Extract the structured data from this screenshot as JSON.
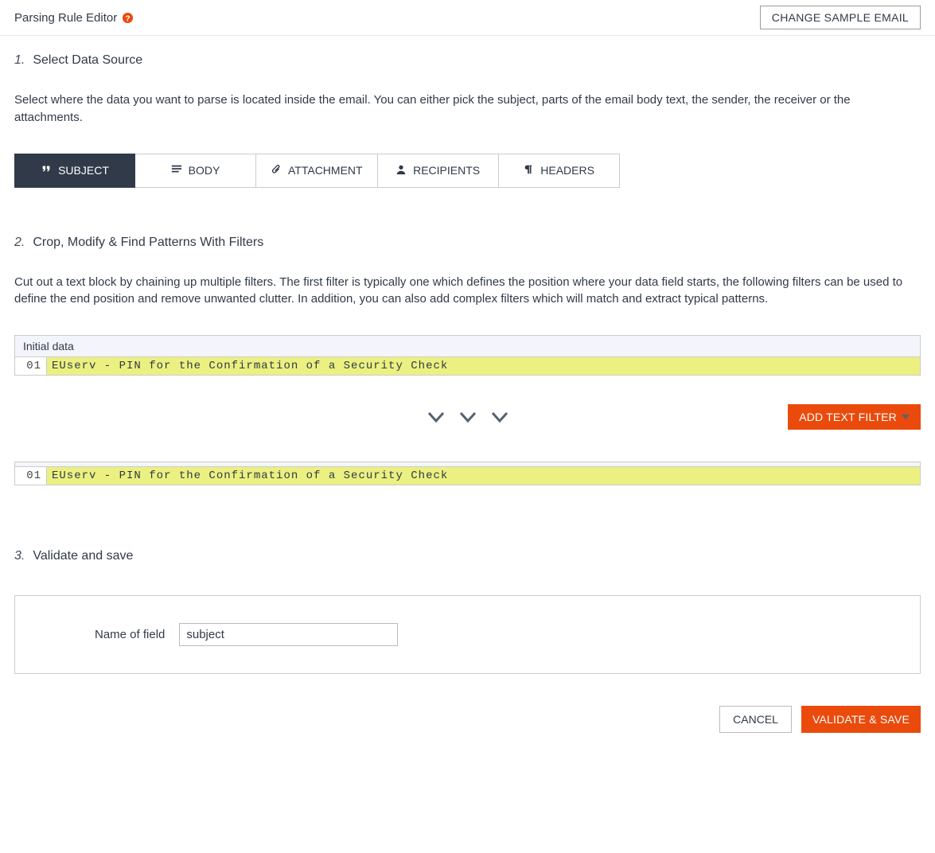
{
  "header": {
    "title": "Parsing Rule Editor",
    "change_sample_label": "CHANGE SAMPLE EMAIL"
  },
  "step1": {
    "num": "1.",
    "title": "Select Data Source",
    "desc": "Select where the data you want to parse is located inside the email. You can either pick the subject, parts of the email body text, the sender, the receiver or the attachments.",
    "tabs": {
      "subject": "SUBJECT",
      "body": "BODY",
      "attachment": "ATTACHMENT",
      "recipients": "RECIPIENTS",
      "headers": "HEADERS"
    }
  },
  "step2": {
    "num": "2.",
    "title": "Crop, Modify & Find Patterns With Filters",
    "desc": "Cut out a text block by chaining up multiple filters. The first filter is typically one which defines the position where your data field starts, the following filters can be used to define the end position and remove unwanted clutter. In addition, you can also add complex filters which will match and extract typical patterns.",
    "initial_data_label": "Initial data",
    "line1_num": "01",
    "line1_text": "EUserv - PIN for the Confirmation of a Security Check",
    "add_filter_label": "ADD TEXT FILTER",
    "line2_num": "01",
    "line2_text": "EUserv - PIN for the Confirmation of a Security Check"
  },
  "step3": {
    "num": "3.",
    "title": "Validate and save",
    "field_label": "Name of field",
    "field_value": "subject"
  },
  "footer": {
    "cancel": "CANCEL",
    "save": "VALIDATE & SAVE"
  }
}
